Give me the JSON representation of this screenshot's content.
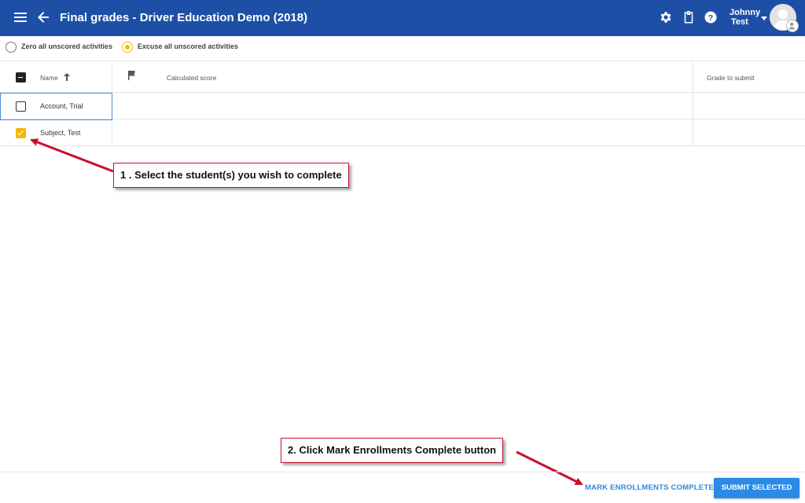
{
  "header": {
    "title": "Final grades - Driver Education Demo (2018)",
    "user_first": "Johnny",
    "user_last": "Test"
  },
  "options": {
    "zero_label": "Zero all unscored activities",
    "excuse_label": "Excuse all unscored activities",
    "selected": "excuse"
  },
  "table": {
    "columns": {
      "name": "Name",
      "calculated": "Calculated score",
      "grade": "Grade to submit"
    },
    "rows": [
      {
        "name": "Account, Trial",
        "checked": false
      },
      {
        "name": "Subject, Test",
        "checked": true
      }
    ]
  },
  "annotations": {
    "step1": "1 . Select the student(s) you wish to complete",
    "step2": "2. Click Mark Enrollments Complete button"
  },
  "footer": {
    "mark_complete_label": "MARK ENROLLMENTS COMPLETE",
    "submit_label": "SUBMIT SELECTED"
  },
  "colors": {
    "appbar": "#1d4fa6",
    "accent": "#f5b800",
    "link": "#2a8ae6",
    "annotation_red": "#c8102e"
  }
}
